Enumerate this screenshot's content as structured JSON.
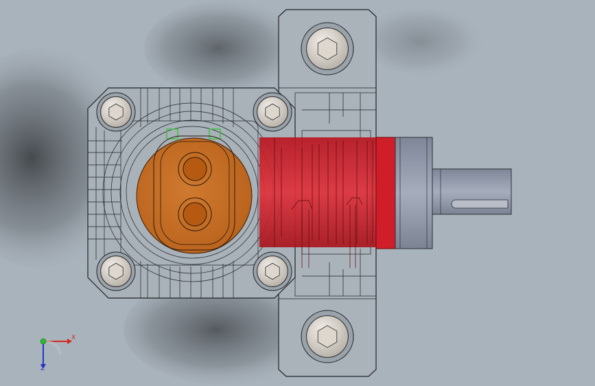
{
  "viewport": {
    "background_color": "#a9b3bc",
    "view": "top"
  },
  "model": {
    "housing_color": "#a8b0b8",
    "edge_color": "#1f2326",
    "gear_color": "#c86c22",
    "gear_bore_color": "#b65a12",
    "highlight_red": "#d41f2a",
    "green_feature_color": "#3ac23a",
    "shaft_color": "#8c93a3",
    "fasteners": [
      {
        "name": "socket-head-cap-screw",
        "icon": "hex-socket"
      },
      {
        "name": "socket-head-cap-screw",
        "icon": "hex-socket"
      },
      {
        "name": "socket-head-cap-screw",
        "icon": "hex-socket"
      },
      {
        "name": "socket-head-cap-screw",
        "icon": "hex-socket"
      },
      {
        "name": "socket-head-cap-screw",
        "icon": "hex-socket"
      },
      {
        "name": "socket-head-cap-screw",
        "icon": "hex-socket"
      }
    ]
  },
  "triad": {
    "x_label": "X",
    "z_label": "Z",
    "x_color": "#d6261e",
    "z_color": "#2436c8",
    "y_color": "#2cba2c"
  }
}
